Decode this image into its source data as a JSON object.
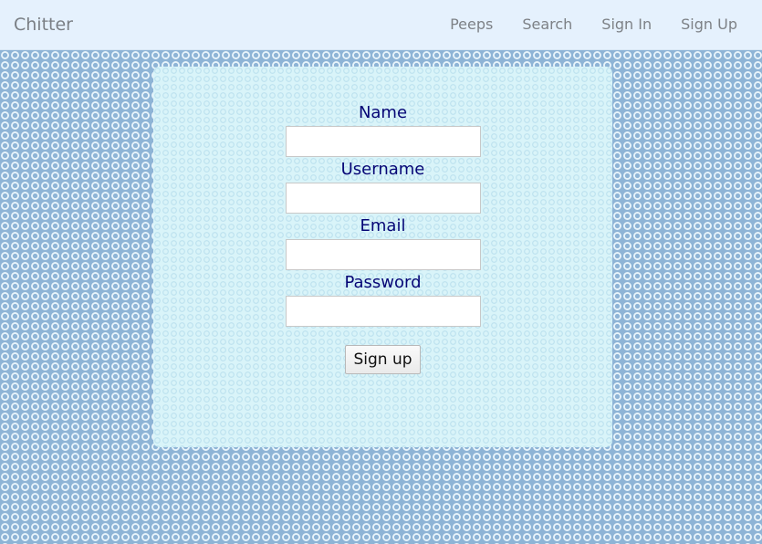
{
  "navbar": {
    "brand": "Chitter",
    "links": [
      {
        "label": "Peeps"
      },
      {
        "label": "Search"
      },
      {
        "label": "Sign In"
      },
      {
        "label": "Sign Up"
      }
    ]
  },
  "form": {
    "fields": [
      {
        "label": "Name",
        "value": "",
        "placeholder": ""
      },
      {
        "label": "Username",
        "value": "",
        "placeholder": ""
      },
      {
        "label": "Email",
        "value": "",
        "placeholder": ""
      },
      {
        "label": "Password",
        "value": "",
        "placeholder": ""
      }
    ],
    "submit_label": "Sign up"
  },
  "colors": {
    "navbar_bg": "#e5f1fd",
    "label_text": "#060676",
    "page_pattern": "#8eb4d6",
    "panel_bg": "#d9f4f9"
  }
}
